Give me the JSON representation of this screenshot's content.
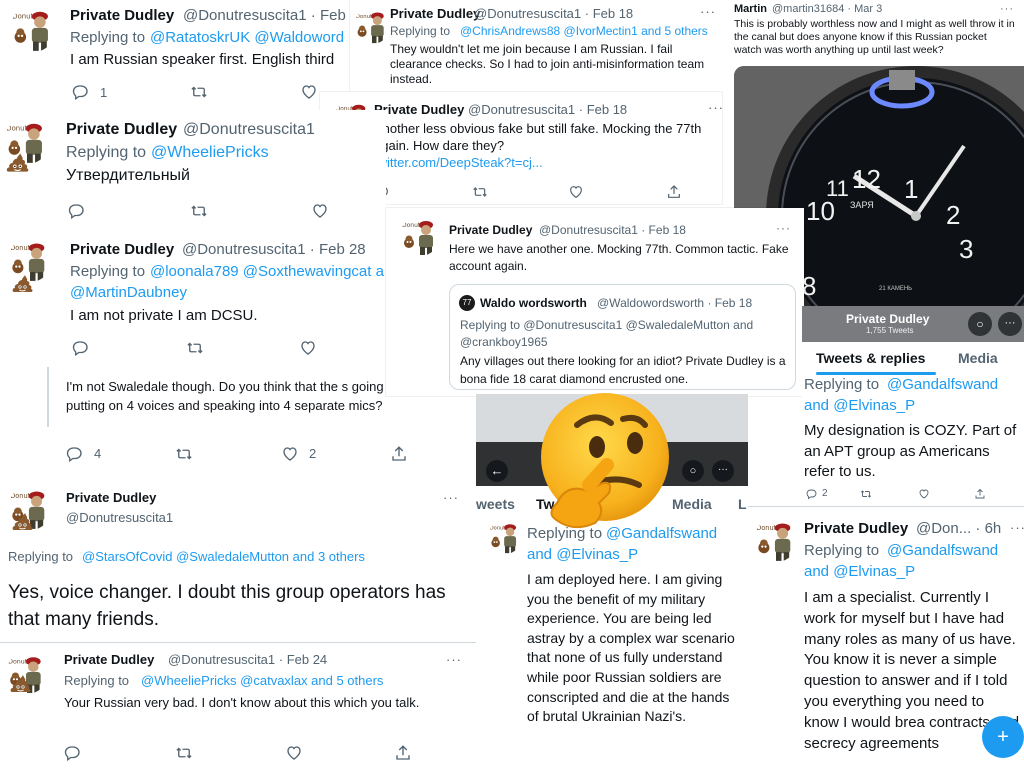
{
  "colors": {
    "link": "#1d9bf0",
    "text": "#0f1419",
    "muted": "#536471",
    "fab": "#1d9bf0",
    "watch_bg": "#5a5a5a"
  },
  "icons": [
    "reply-icon",
    "retweet-icon",
    "like-icon",
    "share-icon",
    "more-icon",
    "back-arrow-icon",
    "search-icon",
    "compose-icon",
    "thinking-face-emoji",
    "poop-emoji",
    "soldier-avatar"
  ],
  "t1": {
    "name": "Private Dudley",
    "handle": "@Donutresuscita1 · Feb",
    "reply_prefix": "Replying to",
    "reply_users": "@RatatoskrUK @Waldoword",
    "body": "I am Russian speaker first. English third",
    "reply_count": "1"
  },
  "t2": {
    "name": "Private Dudley",
    "handle": "@Donutresuscita1 · Feb 18",
    "reply_prefix": "Replying to",
    "reply_users": "@ChrisAndrews88 @IvorMectin1 and 5 others",
    "body": "They wouldn't let me join because I am Russian. I fail clearance checks. So I had to join anti-misinformation team instead."
  },
  "t3": {
    "name": "Martin",
    "handle": "@martin31684 · Mar 3",
    "body": "This is probably worthless now and I might as well throw it in the canal but does anyone know if this Russian pocket watch was worth anything up until last week?",
    "watch_brand": "ЗАРЯ",
    "watch_sub": "21 КАМЕНЬ",
    "numerals": [
      "12",
      "1",
      "2",
      "3",
      "8",
      "10",
      "11"
    ]
  },
  "t4": {
    "name": "Private Dudley",
    "handle": "@Donutresuscita1 · Feb 18",
    "body": "Another less obvious fake but still fake. Mocking the 77th again. How dare they?",
    "link": "twitter.com/DeepSteak?t=cj..."
  },
  "t5": {
    "name": "Private Dudley",
    "handle": "@Donutresuscita1",
    "reply_prefix": "Replying to",
    "reply_users": "@WheeliePricks",
    "body": "Утвердительный"
  },
  "t6": {
    "name": "Private Dudley",
    "handle": "@Donutresuscita1 · Feb 18",
    "body": "Here we have another one. Mocking 77th. Common tactic. Fake account again.",
    "quote": {
      "name": "Waldo wordsworth",
      "handle": "@Waldowordsworth · Feb 18",
      "reply": "Replying to @Donutresuscita1 @SwaledaleMutton and @crankboy1965",
      "body": "Any villages out there looking for an idiot? Private Dudley is a bona fide 18 carat diamond encrusted one."
    }
  },
  "t7": {
    "name": "Private Dudley",
    "handle": "@Donutresuscita1 · Feb 28",
    "reply_prefix": "Replying to",
    "reply_users": "@loonala789 @Soxthewavingcat a",
    "reply_users2": "@MartinDaubney",
    "body": "I am not private I am DCSU."
  },
  "t8": {
    "body": "I'm not Swaledale though. Do you think that the s going to be one guy putting on 4 voices and speaking into 4 separate mics?",
    "reply_count": "4",
    "like_count": "2"
  },
  "profile_header": {
    "name": "Private Dudley",
    "tweets": "1,755 Tweets"
  },
  "tabs_right": {
    "tab1": "Tweets & replies",
    "tab2": "Media"
  },
  "t9": {
    "reply_prefix": "Replying to",
    "reply_users": "@Gandalfswand",
    "reply_users2": "and @Elvinas_P",
    "body": "My designation is COZY. Part of an APT group as Americans refer to us.",
    "reply_count": "2"
  },
  "t10": {
    "name": "Private Dudley",
    "handle": "@Donutresuscita1",
    "reply_prefix": "Replying to",
    "reply_users": "@StarsOfCovid @SwaledaleMutton and 3 others",
    "body": "Yes, voice changer. I doubt this group operators has that many friends."
  },
  "tabs_mid": {
    "tab1": "weets",
    "tab2": "Tw",
    "tab3": "Media",
    "tab4": "L"
  },
  "t11": {
    "reply_prefix": "Replying to",
    "reply_users": "@Gandalfswand",
    "reply_users2": "and @Elvinas_P",
    "body": "I am deployed here. I am giving you the benefit of my military experience. You are being led astray by a complex war scenario that none of us fully understand while poor Russian soldiers are conscripted and die at the hands of brutal Ukrainian Nazi's."
  },
  "t12": {
    "name": "Private Dudley",
    "handle": "@Don... · 6h",
    "reply_prefix": "Replying to",
    "reply_users": "@Gandalfswand",
    "reply_users2": "and @Elvinas_P",
    "body": "I am a specialist. Currently I work for myself but I have had many roles as many of us have. You know it is never a simple question to answer and if I told you everything you need to know I would brea contracts and secrecy agreements"
  },
  "t13": {
    "name": "Private Dudley",
    "handle": "@Donutresuscita1 · Feb 24",
    "reply_prefix": "Replying to",
    "reply_users": "@WheeliePricks @catvaxlax and 5 others",
    "body": "Your Russian very bad. I don't know about this which you talk."
  },
  "more": "···"
}
